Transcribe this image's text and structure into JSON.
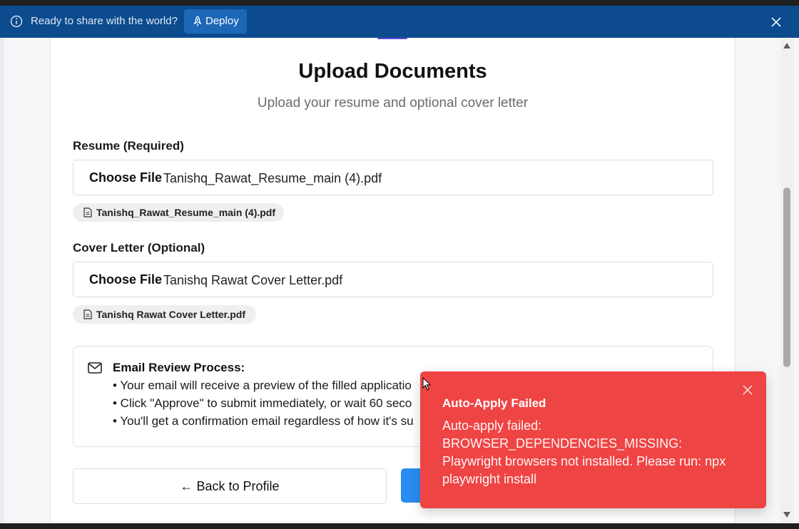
{
  "banner": {
    "text": "Ready to share with the world?",
    "deploy_label": "Deploy",
    "icons": [
      "info-icon",
      "rocket-icon",
      "close-icon"
    ]
  },
  "page": {
    "title": "Upload Documents",
    "subtitle": "Upload your resume and optional cover letter"
  },
  "resume": {
    "label": "Resume (Required)",
    "choose_label": "Choose File",
    "file_name": "Tanishq_Rawat_Resume_main (4).pdf",
    "chip": "Tanishq_Rawat_Resume_main (4).pdf"
  },
  "cover_letter": {
    "label": "Cover Letter (Optional)",
    "choose_label": "Choose File",
    "file_name": "Tanishq Rawat Cover Letter.pdf",
    "chip": "Tanishq Rawat Cover Letter.pdf"
  },
  "email_review": {
    "title": "Email Review Process:",
    "bullets": [
      "• Your email will receive a preview of the filled applicatio",
      "• Click \"Approve\" to submit immediately, or wait 60 seco",
      "• You'll get a confirmation email regardless of how it's su"
    ]
  },
  "actions": {
    "back_label": "← Back to Profile"
  },
  "toast": {
    "title": "Auto-Apply Failed",
    "message": "Auto-apply failed: BROWSER_DEPENDENCIES_MISSING: Playwright browsers not installed. Please run: npx playwright install"
  },
  "colors": {
    "banner": "#0b4b8e",
    "deploy_button": "#1c67b6",
    "primary_button": "#2a8cf0",
    "toast": "#ef4444"
  }
}
